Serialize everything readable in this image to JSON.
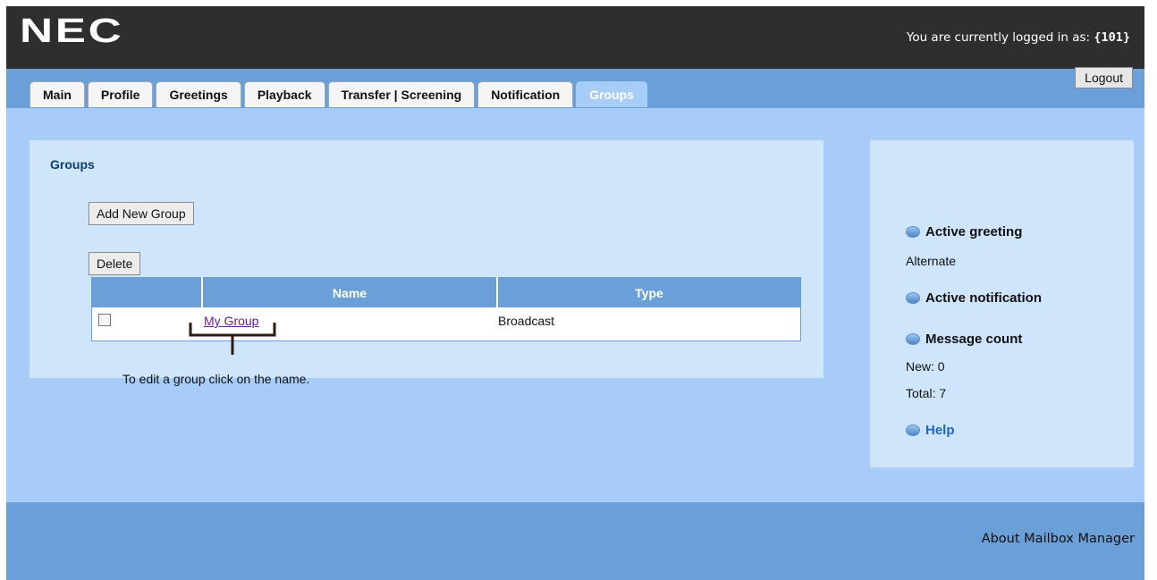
{
  "header": {
    "logo_text": "NEC",
    "login_prefix": "You are currently logged in as:",
    "login_user": "{101}",
    "logout_label": "Logout"
  },
  "tabs": [
    {
      "label": "Main",
      "active": false
    },
    {
      "label": "Profile",
      "active": false
    },
    {
      "label": "Greetings",
      "active": false
    },
    {
      "label": "Playback",
      "active": false
    },
    {
      "label": "Transfer | Screening",
      "active": false
    },
    {
      "label": "Notification",
      "active": false
    },
    {
      "label": "Groups",
      "active": true
    }
  ],
  "groups_panel": {
    "title": "Groups",
    "add_button": "Add New Group",
    "delete_button": "Delete",
    "table": {
      "columns": [
        "",
        "Name",
        "Type"
      ],
      "rows": [
        {
          "checked": false,
          "name": "My Group",
          "type": "Broadcast"
        }
      ]
    },
    "hint": "To edit a group click on the name."
  },
  "side_panel": {
    "active_greeting_title": "Active greeting",
    "active_greeting_value": "Alternate",
    "active_notification_title": "Active notification",
    "message_count_title": "Message count",
    "new_count": "New: 0",
    "total_count": "Total: 7",
    "help_label": "Help",
    "bullet_icon": "blue-orb-icon"
  },
  "footer": {
    "about_link": "About Mailbox Manager"
  },
  "colors": {
    "header_bg": "#2e2e2e",
    "tabbar_bg": "#6b9fd8",
    "main_bg": "#a7ccf7",
    "panel_bg": "#cfe5fb",
    "link": "#6a1b9a",
    "help_link": "#1f67c0"
  }
}
